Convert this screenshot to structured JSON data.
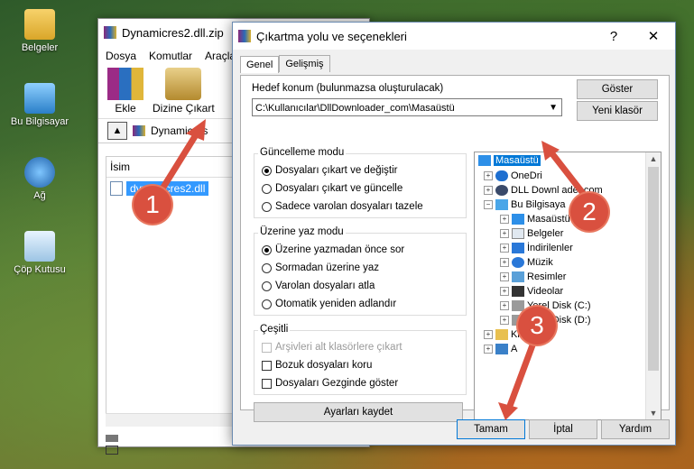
{
  "desktop": {
    "icons": [
      {
        "label": "Belgeler",
        "icon": "documents-folder-icon"
      },
      {
        "label": "Bu Bilgisayar",
        "icon": "computer-icon"
      },
      {
        "label": "Ağ",
        "icon": "network-icon"
      },
      {
        "label": "Çöp Kutusu",
        "icon": "recycle-bin-icon"
      }
    ]
  },
  "winrar": {
    "title": "Dynamicres2.dll.zip",
    "menu": [
      "Dosya",
      "Komutlar",
      "Araçla"
    ],
    "tools": {
      "add": "Ekle",
      "extract": "Dizine Çıkart"
    },
    "path": "Dynamicres",
    "column_name": "İsim",
    "file": "dynamicres2.dll"
  },
  "dialog": {
    "title": "Çıkartma yolu ve seçenekleri",
    "help_symbol": "?",
    "close_symbol": "✕",
    "tabs": [
      "Genel",
      "Gelişmiş"
    ],
    "dest_label": "Hedef konum (bulunmazsa oluşturulacak)",
    "dest_value": "C:\\Kullanıcılar\\DllDownloader_com\\Masaüstü",
    "show_button": "Göster",
    "new_folder_button": "Yeni klasör",
    "update_group": {
      "title": "Güncelleme modu",
      "options": [
        "Dosyaları çıkart ve değiştir",
        "Dosyaları çıkart ve güncelle",
        "Sadece varolan dosyaları tazele"
      ],
      "selected": 0
    },
    "overwrite_group": {
      "title": "Üzerine yaz modu",
      "options": [
        "Üzerine yazmadan önce sor",
        "Sormadan üzerine yaz",
        "Varolan dosyaları atla",
        "Otomatik yeniden adlandır"
      ],
      "selected": 0
    },
    "misc_group": {
      "title": "Çeşitli",
      "options": [
        "Arşivleri alt klasörlere çıkart",
        "Bozuk dosyaları koru",
        "Dosyaları Gezginde göster"
      ]
    },
    "save_settings_button": "Ayarları kaydet",
    "tree": [
      {
        "label": "Masaüstü",
        "level": 0
      },
      {
        "label": "OneDri",
        "level": 1
      },
      {
        "label": "DLL Downl",
        "suffix": "ader.com",
        "level": 1
      },
      {
        "label": "Bu Bilgisaya",
        "level": 1
      },
      {
        "label": "Masaüstü",
        "level": 2
      },
      {
        "label": "Belgeler",
        "level": 2
      },
      {
        "label": "İndirilenler",
        "level": 2
      },
      {
        "label": "Müzik",
        "level": 2
      },
      {
        "label": "Resimler",
        "level": 2
      },
      {
        "label": "Videolar",
        "level": 2
      },
      {
        "label": "Yerel Disk (C:)",
        "level": 2
      },
      {
        "label": "Yerel Disk (D:)",
        "level": 2
      },
      {
        "label": "Kit",
        "level": 1
      },
      {
        "label": "A",
        "level": 1
      }
    ],
    "ok_button": "Tamam",
    "cancel_button": "İptal",
    "help_button": "Yardım"
  },
  "annotations": {
    "steps": [
      "1",
      "2",
      "3"
    ],
    "color": "#d9503f"
  }
}
